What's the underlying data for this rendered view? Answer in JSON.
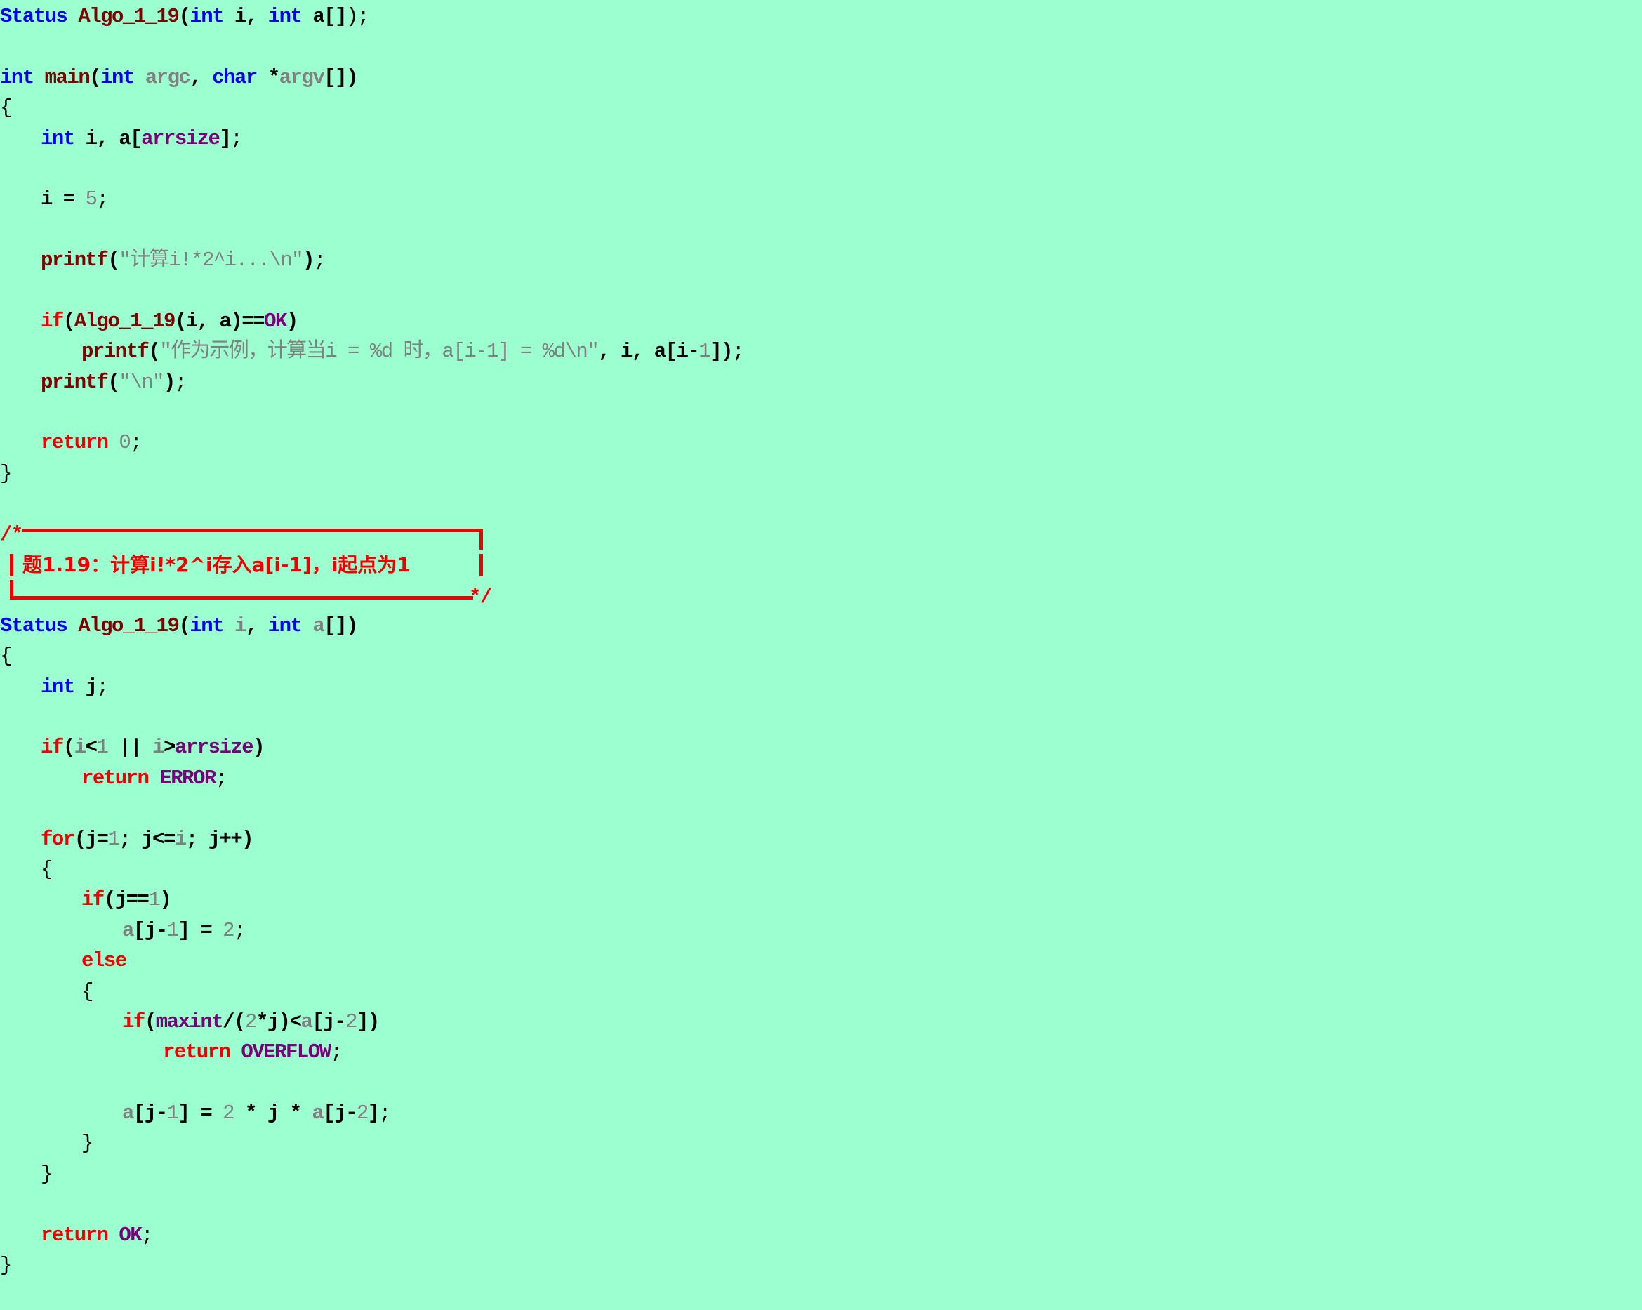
{
  "editor": {
    "background": "#9cffd0",
    "colors": {
      "keyword": "#ee0000",
      "type": "#0000ee",
      "function": "#800000",
      "macro": "#7a007a",
      "param": "#808080",
      "string": "#808080",
      "number": "#808080",
      "plain": "#000000"
    }
  },
  "lines": [
    {
      "indent": 0,
      "tokens": [
        [
          "type",
          "Status"
        ],
        [
          "plain",
          " "
        ],
        [
          "func",
          "Algo_1_19"
        ],
        [
          "plain",
          "("
        ],
        [
          "type",
          "int"
        ],
        [
          "plain",
          " i, "
        ],
        [
          "type",
          "int"
        ],
        [
          "plain",
          " a[]"
        ],
        [
          "punct",
          ");"
        ]
      ]
    },
    {
      "indent": 0,
      "tokens": []
    },
    {
      "indent": 0,
      "tokens": [
        [
          "type",
          "int"
        ],
        [
          "plain",
          " "
        ],
        [
          "func",
          "main"
        ],
        [
          "plain",
          "("
        ],
        [
          "type",
          "int"
        ],
        [
          "plain",
          " "
        ],
        [
          "param",
          "argc"
        ],
        [
          "plain",
          ", "
        ],
        [
          "type",
          "char"
        ],
        [
          "plain",
          " *"
        ],
        [
          "param",
          "argv"
        ],
        [
          "plain",
          "[])"
        ]
      ]
    },
    {
      "indent": 0,
      "tokens": [
        [
          "punct",
          "{"
        ]
      ]
    },
    {
      "indent": 1,
      "tokens": [
        [
          "type",
          "int"
        ],
        [
          "plain",
          " i, a["
        ],
        [
          "macro",
          "arrsize"
        ],
        [
          "plain",
          "]"
        ],
        [
          "punct",
          ";"
        ]
      ]
    },
    {
      "indent": 0,
      "tokens": []
    },
    {
      "indent": 1,
      "tokens": [
        [
          "plain",
          "i = "
        ],
        [
          "number",
          "5"
        ],
        [
          "punct",
          ";"
        ]
      ]
    },
    {
      "indent": 0,
      "tokens": []
    },
    {
      "indent": 1,
      "tokens": [
        [
          "func",
          "printf"
        ],
        [
          "plain",
          "("
        ],
        [
          "string",
          "\"计算i!*2^i...\\n\""
        ],
        [
          "plain",
          ")"
        ],
        [
          "punct",
          ";"
        ]
      ]
    },
    {
      "indent": 0,
      "tokens": []
    },
    {
      "indent": 1,
      "tokens": [
        [
          "keyword",
          "if"
        ],
        [
          "plain",
          "("
        ],
        [
          "func",
          "Algo_1_19"
        ],
        [
          "plain",
          "(i, a)=="
        ],
        [
          "macro",
          "OK"
        ],
        [
          "plain",
          ")"
        ]
      ]
    },
    {
      "indent": 2,
      "tokens": [
        [
          "func",
          "printf"
        ],
        [
          "plain",
          "("
        ],
        [
          "string",
          "\"作为示例，计算当i = %d 时，a[i-1] = %d\\n\""
        ],
        [
          "plain",
          ", i, a[i-"
        ],
        [
          "number",
          "1"
        ],
        [
          "plain",
          "])"
        ],
        [
          "punct",
          ";"
        ]
      ]
    },
    {
      "indent": 1,
      "tokens": [
        [
          "func",
          "printf"
        ],
        [
          "plain",
          "("
        ],
        [
          "string",
          "\"\\n\""
        ],
        [
          "plain",
          ")"
        ],
        [
          "punct",
          ";"
        ]
      ]
    },
    {
      "indent": 0,
      "tokens": []
    },
    {
      "indent": 1,
      "tokens": [
        [
          "keyword",
          "return"
        ],
        [
          "plain",
          " "
        ],
        [
          "number",
          "0"
        ],
        [
          "punct",
          ";"
        ]
      ]
    },
    {
      "indent": 0,
      "tokens": [
        [
          "punct",
          "}"
        ]
      ]
    },
    {
      "indent": 0,
      "tokens": []
    }
  ],
  "comment_box": {
    "open": "/*",
    "close": "*/",
    "text": "题1.19：计算i!*2^i存入a[i-1]，i起点为1"
  },
  "lines2": [
    {
      "indent": 0,
      "tokens": [
        [
          "type",
          "Status"
        ],
        [
          "plain",
          " "
        ],
        [
          "func",
          "Algo_1_19"
        ],
        [
          "plain",
          "("
        ],
        [
          "type",
          "int"
        ],
        [
          "plain",
          " "
        ],
        [
          "param",
          "i"
        ],
        [
          "plain",
          ", "
        ],
        [
          "type",
          "int"
        ],
        [
          "plain",
          " "
        ],
        [
          "param",
          "a"
        ],
        [
          "plain",
          "[])"
        ]
      ]
    },
    {
      "indent": 0,
      "tokens": [
        [
          "punct",
          "{"
        ]
      ]
    },
    {
      "indent": 1,
      "tokens": [
        [
          "type",
          "int"
        ],
        [
          "plain",
          " j"
        ],
        [
          "punct",
          ";"
        ]
      ]
    },
    {
      "indent": 0,
      "tokens": []
    },
    {
      "indent": 1,
      "tokens": [
        [
          "keyword",
          "if"
        ],
        [
          "plain",
          "("
        ],
        [
          "param",
          "i"
        ],
        [
          "plain",
          "<"
        ],
        [
          "number",
          "1"
        ],
        [
          "plain",
          " || "
        ],
        [
          "param",
          "i"
        ],
        [
          "plain",
          ">"
        ],
        [
          "macro",
          "arrsize"
        ],
        [
          "plain",
          ")"
        ]
      ]
    },
    {
      "indent": 2,
      "tokens": [
        [
          "keyword",
          "return"
        ],
        [
          "plain",
          " "
        ],
        [
          "macro",
          "ERROR"
        ],
        [
          "punct",
          ";"
        ]
      ]
    },
    {
      "indent": 0,
      "tokens": []
    },
    {
      "indent": 1,
      "tokens": [
        [
          "keyword",
          "for"
        ],
        [
          "plain",
          "(j="
        ],
        [
          "number",
          "1"
        ],
        [
          "plain",
          "; j<="
        ],
        [
          "param",
          "i"
        ],
        [
          "plain",
          "; j++)"
        ]
      ]
    },
    {
      "indent": 1,
      "tokens": [
        [
          "punct",
          "{"
        ]
      ]
    },
    {
      "indent": 2,
      "tokens": [
        [
          "keyword",
          "if"
        ],
        [
          "plain",
          "(j=="
        ],
        [
          "number",
          "1"
        ],
        [
          "plain",
          ")"
        ]
      ]
    },
    {
      "indent": 3,
      "tokens": [
        [
          "param",
          "a"
        ],
        [
          "plain",
          "[j-"
        ],
        [
          "number",
          "1"
        ],
        [
          "plain",
          "] = "
        ],
        [
          "number",
          "2"
        ],
        [
          "punct",
          ";"
        ]
      ]
    },
    {
      "indent": 2,
      "tokens": [
        [
          "keyword",
          "else"
        ]
      ]
    },
    {
      "indent": 2,
      "tokens": [
        [
          "punct",
          "{"
        ]
      ]
    },
    {
      "indent": 3,
      "tokens": [
        [
          "keyword",
          "if"
        ],
        [
          "plain",
          "("
        ],
        [
          "macro",
          "maxint"
        ],
        [
          "plain",
          "/("
        ],
        [
          "number",
          "2"
        ],
        [
          "plain",
          "*j)<"
        ],
        [
          "param",
          "a"
        ],
        [
          "plain",
          "[j-"
        ],
        [
          "number",
          "2"
        ],
        [
          "plain",
          "])"
        ]
      ]
    },
    {
      "indent": 4,
      "tokens": [
        [
          "keyword",
          "return"
        ],
        [
          "plain",
          " "
        ],
        [
          "macro",
          "OVERFLOW"
        ],
        [
          "punct",
          ";"
        ]
      ]
    },
    {
      "indent": 0,
      "tokens": []
    },
    {
      "indent": 3,
      "tokens": [
        [
          "param",
          "a"
        ],
        [
          "plain",
          "[j-"
        ],
        [
          "number",
          "1"
        ],
        [
          "plain",
          "] = "
        ],
        [
          "number",
          "2"
        ],
        [
          "plain",
          " * j * "
        ],
        [
          "param",
          "a"
        ],
        [
          "plain",
          "[j-"
        ],
        [
          "number",
          "2"
        ],
        [
          "plain",
          "]"
        ],
        [
          "punct",
          ";"
        ]
      ]
    },
    {
      "indent": 2,
      "tokens": [
        [
          "punct",
          "}"
        ]
      ]
    },
    {
      "indent": 1,
      "tokens": [
        [
          "punct",
          "}"
        ]
      ]
    },
    {
      "indent": 0,
      "tokens": []
    },
    {
      "indent": 1,
      "tokens": [
        [
          "keyword",
          "return"
        ],
        [
          "plain",
          " "
        ],
        [
          "macro",
          "OK"
        ],
        [
          "punct",
          ";"
        ]
      ]
    },
    {
      "indent": 0,
      "tokens": [
        [
          "punct",
          "}"
        ]
      ]
    }
  ]
}
